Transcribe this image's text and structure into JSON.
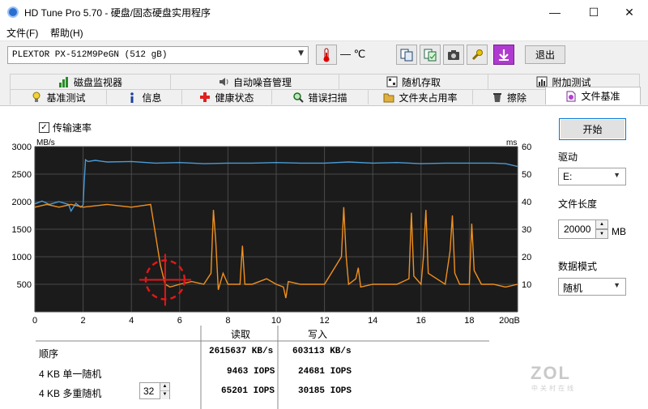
{
  "window": {
    "title": "HD Tune Pro 5.70 - 硬盘/固态硬盘实用程序",
    "minimize": "—",
    "maximize": "☐",
    "close": "✕"
  },
  "menu": {
    "file": "文件(F)",
    "help": "帮助(H)"
  },
  "toolbar": {
    "drive": "PLEXTOR PX-512M9PeGN (512 gB)",
    "temperature": "— ℃",
    "exit_label": "退出"
  },
  "tabs": {
    "row1": [
      {
        "label": "磁盘监视器",
        "icon": "bar-chart-icon"
      },
      {
        "label": "自动噪音管理",
        "icon": "speaker-icon"
      },
      {
        "label": "随机存取",
        "icon": "random-access-icon"
      },
      {
        "label": "附加测试",
        "icon": "extra-tests-icon"
      }
    ],
    "row2": [
      {
        "label": "基准测试",
        "icon": "lightbulb-icon"
      },
      {
        "label": "信息",
        "icon": "info-icon"
      },
      {
        "label": "健康状态",
        "icon": "health-cross-icon"
      },
      {
        "label": "错误扫描",
        "icon": "magnifier-icon"
      },
      {
        "label": "文件夹占用率",
        "icon": "folder-icon"
      },
      {
        "label": "擦除",
        "icon": "trash-icon"
      },
      {
        "label": "文件基准",
        "icon": "file-benchmark-icon"
      }
    ]
  },
  "benchmark": {
    "transfer_rate_label": "传输速率",
    "transfer_rate_checked": true
  },
  "sidebar": {
    "start_label": "开始",
    "drive_label": "驱动",
    "drive_value": "E:",
    "file_length_label": "文件长度",
    "file_length_value": "20000",
    "file_length_unit": "MB",
    "data_mode_label": "数据模式",
    "data_mode_value": "随机"
  },
  "results": {
    "read_header": "读取",
    "write_header": "写入",
    "rows": [
      {
        "label": "顺序",
        "read": "2615637 KB/s",
        "write": "603113 KB/s"
      },
      {
        "label": "4 KB 单一随机",
        "read": "9463 IOPS",
        "write": "24681 IOPS"
      },
      {
        "label": "4 KB 多重随机",
        "read": "65201 IOPS",
        "write": "30185 IOPS"
      }
    ],
    "queue_depth": "32"
  },
  "watermark": {
    "logo": "ZOL",
    "sub": "中关村在线"
  },
  "colors": {
    "read_line": "#4a9bd6",
    "write_line": "#f0901e",
    "chart_bg": "#1b1b1b",
    "grid": "#4a4a4a",
    "annotation": "#e01818"
  },
  "chart_data": {
    "type": "line",
    "left_unit": "MB/s",
    "right_unit": "ms",
    "x_unit": "gB",
    "x_ticks": [
      "0",
      "2",
      "4",
      "6",
      "8",
      "10",
      "12",
      "14",
      "16",
      "18",
      "20gB"
    ],
    "y_left_ticks": [
      "3000",
      "2500",
      "2000",
      "1500",
      "1000",
      "500"
    ],
    "y_right_ticks": [
      "60",
      "50",
      "40",
      "30",
      "20",
      "10"
    ],
    "xlim": [
      0,
      20
    ],
    "ylim_left": [
      0,
      3000
    ],
    "ylim_right": [
      0,
      60
    ],
    "series": [
      {
        "axis": "left",
        "color": "#4a9bd6",
        "x": [
          0,
          0.3,
          0.6,
          1.0,
          1.4,
          1.5,
          1.7,
          1.9,
          2.0,
          2.05,
          2.1,
          2.2,
          2.5,
          3,
          4,
          5,
          6,
          7,
          8,
          9,
          10,
          11,
          12,
          13,
          14,
          15,
          16,
          17,
          18,
          19,
          19.5,
          20
        ],
        "y": [
          1960,
          2010,
          1950,
          2000,
          1950,
          1830,
          1970,
          1900,
          1940,
          2400,
          2760,
          2730,
          2750,
          2720,
          2730,
          2700,
          2710,
          2690,
          2700,
          2700,
          2710,
          2700,
          2700,
          2720,
          2700,
          2710,
          2690,
          2700,
          2700,
          2700,
          2690,
          2640
        ]
      },
      {
        "axis": "right",
        "color": "#f0901e",
        "x": [
          0,
          0.5,
          1,
          1.5,
          2,
          3,
          4,
          4.8,
          5.2,
          5.4,
          5.6,
          6,
          6.5,
          7,
          7.3,
          7.4,
          7.5,
          7.6,
          7.8,
          8,
          8.5,
          8.6,
          8.7,
          9,
          9.6,
          10,
          10.3,
          10.4,
          10.5,
          11,
          12,
          12.7,
          12.8,
          12.9,
          13,
          13.3,
          13.4,
          13.5,
          14,
          15,
          15.5,
          15.6,
          15.7,
          16,
          16.1,
          16.2,
          16.3,
          17,
          17.2,
          17.3,
          17.4,
          17.6,
          18,
          18.1,
          18.2,
          18.5,
          19,
          19.5,
          20
        ],
        "y": [
          38,
          39,
          38,
          39,
          38,
          39,
          38,
          39,
          17,
          10,
          9,
          10,
          11,
          10,
          14,
          37,
          25,
          8,
          14,
          10,
          10,
          24,
          10,
          10,
          12,
          10,
          9,
          5,
          11,
          10,
          10,
          20,
          38,
          20,
          10,
          12,
          16,
          9,
          10,
          10,
          12,
          36,
          13,
          10,
          20,
          37,
          14,
          10,
          22,
          35,
          14,
          10,
          10,
          32,
          15,
          10,
          10,
          9,
          10
        ]
      }
    ],
    "annotation": {
      "type": "circle-crosshair",
      "x": 5.4,
      "y_left": 580
    }
  }
}
